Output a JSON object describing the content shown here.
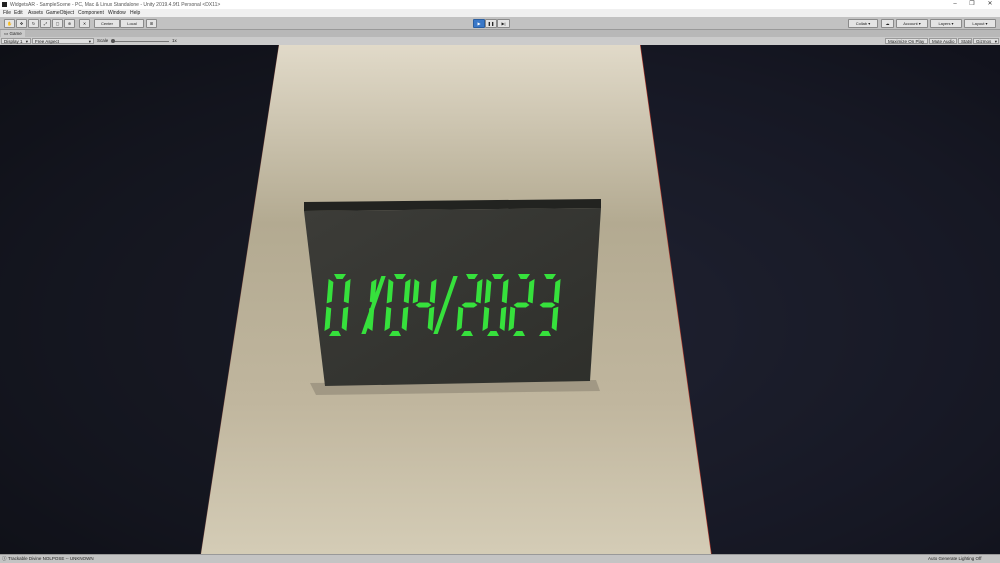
{
  "window": {
    "title": "WidgetsAR - SampleScene - PC, Mac & Linux Standalone - Unity 2019.4.9f1 Personal <DX11>",
    "controls": [
      "–",
      "❐",
      "✕"
    ]
  },
  "menu": [
    "File",
    "Edit",
    "Assets",
    "GameObject",
    "Component",
    "Window",
    "Help"
  ],
  "toolbar": {
    "tools": [
      "hand-tool-icon",
      "move-tool-icon",
      "rotate-tool-icon",
      "scale-tool-icon",
      "rect-tool-icon",
      "transform-tool-icon"
    ],
    "pivot_label": "Center",
    "space_label": "Local",
    "collab_label": "Collab ▾",
    "account_label": "Account ▾",
    "layers_label": "Layers ▾",
    "layout_label": "Layout ▾"
  },
  "tab": {
    "label": "Game"
  },
  "gamebar": {
    "display": "Display 1",
    "aspect": "Free Aspect",
    "scale_label": "Scale",
    "scale_value": "1x",
    "maximize": "Maximize On Play",
    "mute": "Mute Audio",
    "stats": "Stats",
    "gizmos": "Gizmos"
  },
  "scene": {
    "display_text": "01/04/2023",
    "digit_color": "#36e13c"
  },
  "status": {
    "left": "Trackable Divine NOLPOSE -- UNKNOWN",
    "right": "Auto Generate Lighting Off"
  }
}
